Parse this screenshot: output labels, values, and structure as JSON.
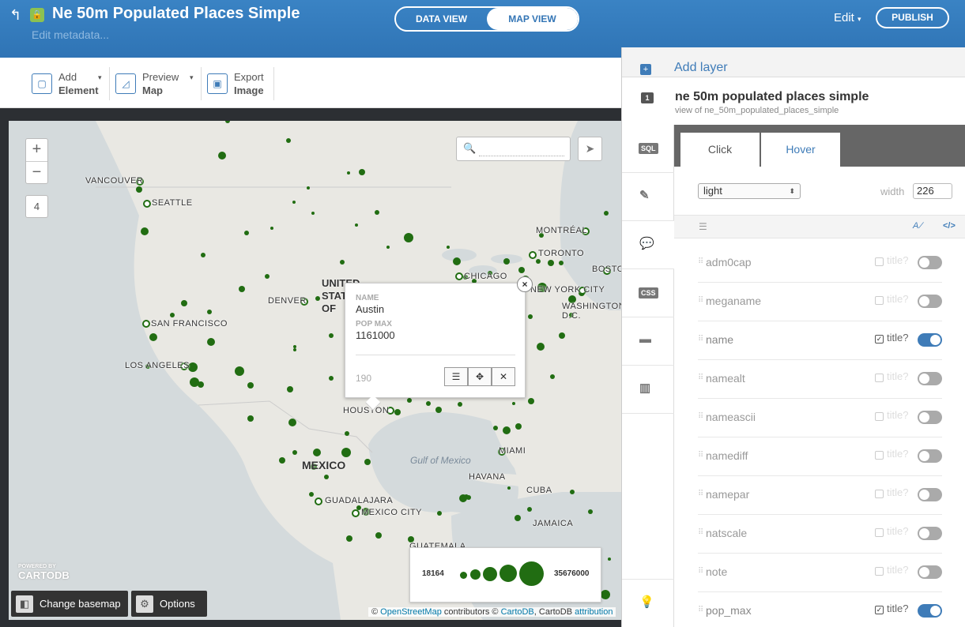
{
  "header": {
    "title": "Ne 50m Populated Places Simple",
    "edit_metadata": "Edit metadata...",
    "data_view": "DATA VIEW",
    "map_view": "MAP VIEW",
    "edit_menu": "Edit",
    "publish": "PUBLISH"
  },
  "toolbar": {
    "add_element": {
      "line1": "Add",
      "line2": "Element"
    },
    "preview_map": {
      "line1": "Preview",
      "line2": "Map"
    },
    "export_image": {
      "line1": "Export",
      "line2": "Image"
    }
  },
  "map": {
    "zoom_in": "+",
    "zoom_out": "−",
    "zoom_level": "4",
    "search_placeholder": "",
    "cities": [
      {
        "name": "VANCOUVER"
      },
      {
        "name": "SEATTLE"
      },
      {
        "name": "MONTRÉAL"
      },
      {
        "name": "TORONTO"
      },
      {
        "name": "BOSTON"
      },
      {
        "name": "CHICAGO"
      },
      {
        "name": "NEW YORK CITY"
      },
      {
        "name": "DENVER"
      },
      {
        "name": "WASHINGTON, D.C."
      },
      {
        "name": "SAN FRANCISCO"
      },
      {
        "name": "LOS ANGELES"
      },
      {
        "name": "HOUSTON"
      },
      {
        "name": "MIAMI"
      },
      {
        "name": "HAVANA"
      },
      {
        "name": "GUADALAJARA"
      },
      {
        "name": "MEXICO CITY"
      },
      {
        "name": "CUBA"
      },
      {
        "name": "JAMAICA"
      },
      {
        "name": "GUATEMALA"
      }
    ],
    "country_mexico": "MEXICO",
    "country_us_partial": "UNITED STATES OF AMERICA",
    "sea_gulf": "Gulf of Mexico",
    "popup": {
      "name_label": "NAME",
      "name_value": "Austin",
      "pop_label": "POP MAX",
      "pop_value": "1161000",
      "id": "190"
    },
    "legend": {
      "min": "18164",
      "max": "35676000"
    },
    "logo_small": "POWERED BY",
    "logo": "CARTODB",
    "change_basemap": "Change basemap",
    "options": "Options",
    "attribution": {
      "prefix": "©",
      "osm": "OpenStreetMap",
      "middle": "contributors ©",
      "cartodb": "CartoDB",
      "sep": ", CartoDB",
      "attr": "attribution"
    },
    "colors": {
      "point": "#216d12",
      "land": "#e9e8e3",
      "water": "#d4dadc"
    }
  },
  "panel": {
    "add_layer": "Add layer",
    "layer_number": "1",
    "layer_name": "ne 50m populated places simple",
    "layer_sub": "view of ne_50m_populated_places_simple",
    "side_tabs": [
      "SQL",
      "wizard",
      "infowindow",
      "CSS",
      "legend",
      "filters",
      "bulb"
    ],
    "tabs": {
      "click": "Click",
      "hover": "Hover"
    },
    "theme": "light",
    "width_label": "width",
    "width_value": "226",
    "fields_toggle_a": "A ∕",
    "fields_toggle_b": "</>",
    "fields": [
      {
        "name": "adm0cap",
        "title_checked": false,
        "enabled": false
      },
      {
        "name": "meganame",
        "title_checked": false,
        "enabled": false
      },
      {
        "name": "name",
        "title_checked": true,
        "enabled": true
      },
      {
        "name": "namealt",
        "title_checked": false,
        "enabled": false
      },
      {
        "name": "nameascii",
        "title_checked": false,
        "enabled": false
      },
      {
        "name": "namediff",
        "title_checked": false,
        "enabled": false
      },
      {
        "name": "namepar",
        "title_checked": false,
        "enabled": false
      },
      {
        "name": "natscale",
        "title_checked": false,
        "enabled": false
      },
      {
        "name": "note",
        "title_checked": false,
        "enabled": false
      },
      {
        "name": "pop_max",
        "title_checked": true,
        "enabled": true
      }
    ],
    "title_label": "title?"
  }
}
